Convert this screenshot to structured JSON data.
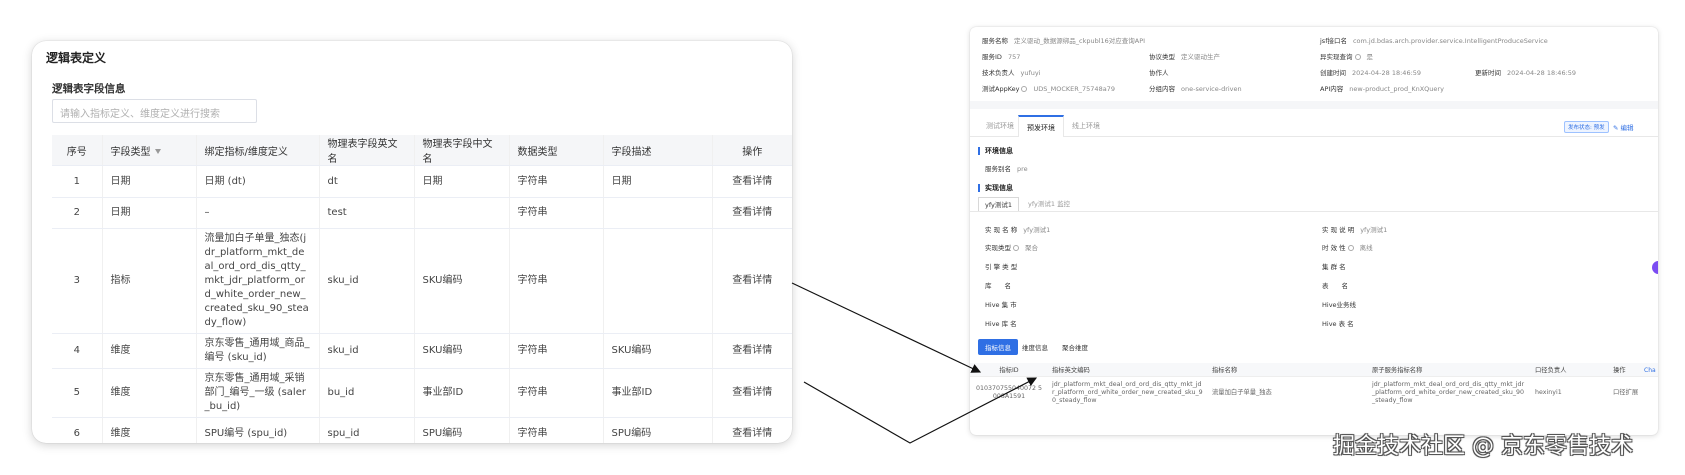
{
  "left": {
    "title": "逻辑表定义",
    "subtitle": "逻辑表字段信息",
    "search_placeholder": "请输入指标定义、维度定义进行搜索",
    "headers": [
      "序号",
      "字段类型",
      "绑定指标/维度定义",
      "物理表字段英文名",
      "物理表字段中文名",
      "数据类型",
      "字段描述",
      "操作"
    ],
    "rows": [
      {
        "no": "1",
        "type": "日期",
        "binding": "日期 (dt)",
        "binding_link": true,
        "en": "dt",
        "cn": "日期",
        "dtype": "字符串",
        "desc": "日期",
        "op": "查看详情"
      },
      {
        "no": "2",
        "type": "日期",
        "binding": "–",
        "binding_link": false,
        "en": "test",
        "cn": "",
        "dtype": "字符串",
        "desc": "",
        "op": "查看详情"
      },
      {
        "no": "3",
        "type": "指标",
        "binding": "流量加白子单量_独态(jdr_platform_mkt_deal_ord_ord_dis_qtty_mkt_jdr_platform_ord_white_order_new_created_sku_90_steady_flow)",
        "binding_link": true,
        "en": "sku_id",
        "cn": "SKU编码",
        "dtype": "字符串",
        "desc": "",
        "op": "查看详情"
      },
      {
        "no": "4",
        "type": "维度",
        "binding": "京东零售_通用域_商品_编号 (sku_id)",
        "binding_link": true,
        "en": "sku_id",
        "cn": "SKU编码",
        "dtype": "字符串",
        "desc": "SKU编码",
        "op": "查看详情"
      },
      {
        "no": "5",
        "type": "维度",
        "binding": "京东零售_通用域_采销部门_编号_一级 (saler_bu_id)",
        "binding_link": true,
        "en": "bu_id",
        "cn": "事业部ID",
        "dtype": "字符串",
        "desc": "事业部ID",
        "op": "查看详情"
      },
      {
        "no": "6",
        "type": "维度",
        "binding": "SPU编号 (spu_id)",
        "binding_link": true,
        "en": "spu_id",
        "cn": "SPU编码",
        "dtype": "字符串",
        "desc": "SPU编码",
        "op": "查看详情"
      }
    ]
  },
  "right": {
    "info": {
      "service_name_label": "服务名称",
      "service_name": "定义驱动_数据源绑品_ckpubl16对应查询API",
      "jsf_label": "jsf接口名",
      "jsf": "com.jd.bdas.arch.provider.service.IntelligentProduceService",
      "service_id_label": "服务ID",
      "service_id": "757",
      "protocol_label": "协议类型",
      "protocol": "定义驱动生产",
      "async_label": "异实现查询",
      "async": "是",
      "owner_label": "技术负责人",
      "owner": "yufuyi",
      "collab_label": "协作人",
      "collab": "",
      "created_label": "创建时间",
      "created": "2024-04-28 18:46:59",
      "updated_label": "更新时间",
      "updated": "2024-04-28 18:46:59",
      "appkey_label": "测试AppKey",
      "appkey": "UDS_MOCKER_75748a79",
      "group_label": "分组内容",
      "group": "one-service-driven",
      "api_label": "API内容",
      "api": "new-product_prod_KnXQuery"
    },
    "env_tabs": [
      "测试环境",
      "预发环境",
      "线上环境"
    ],
    "status_pill": "发布状态: 预发",
    "edit_label": "编辑",
    "env_section": "环境信息",
    "env_alias_label": "服务别名",
    "env_alias": "pre",
    "impl_section": "实现信息",
    "impl_tabs": [
      "yfy测试1",
      "yfy测试1 监控"
    ],
    "impl_fields_left": [
      {
        "label": "实 现 名 称",
        "value": "yfy测试1"
      },
      {
        "label": "实现类型",
        "value": "聚合"
      },
      {
        "label": "引 擎 类 型",
        "value": ""
      },
      {
        "label": "库　　名",
        "value": ""
      },
      {
        "label": "Hive 集 市",
        "value": ""
      },
      {
        "label": "Hive 库 名",
        "value": ""
      }
    ],
    "impl_fields_right": [
      {
        "label": "实 现 说 明",
        "value": "yfy测试1"
      },
      {
        "label": "时 效 性",
        "value": "离线"
      },
      {
        "label": "集 群 名",
        "value": ""
      },
      {
        "label": "表　　名",
        "value": ""
      },
      {
        "label": "Hive业务线",
        "value": ""
      },
      {
        "label": "Hive 表 名",
        "value": ""
      }
    ],
    "metric_tabs": [
      "指标信息",
      "维度信息",
      "聚合维度"
    ],
    "table_headers": [
      "指标ID",
      "指标英文编码",
      "指标名称",
      "原子服务指标名称",
      "口径负责人",
      "操作"
    ],
    "table_row": {
      "id": "010370755040072 5008A1591",
      "en": "jdr_platform_mkt_deal_ord_ord_dis_qtty_mkt_jdr_platform_ord_white_order_new_created_sku_90_steady_flow",
      "name": "流量加白子单量_独态",
      "atomic": "jdr_platform_mkt_deal_ord_ord_dis_qtty_mkt_jdr_platform_ord_white_order_new_created_sku_90_steady_flow",
      "owner": "hexinyi1",
      "op": "口径扩展"
    },
    "side_label": "Cha"
  },
  "watermark": "掘金技术社区 @ 京东零售技术"
}
